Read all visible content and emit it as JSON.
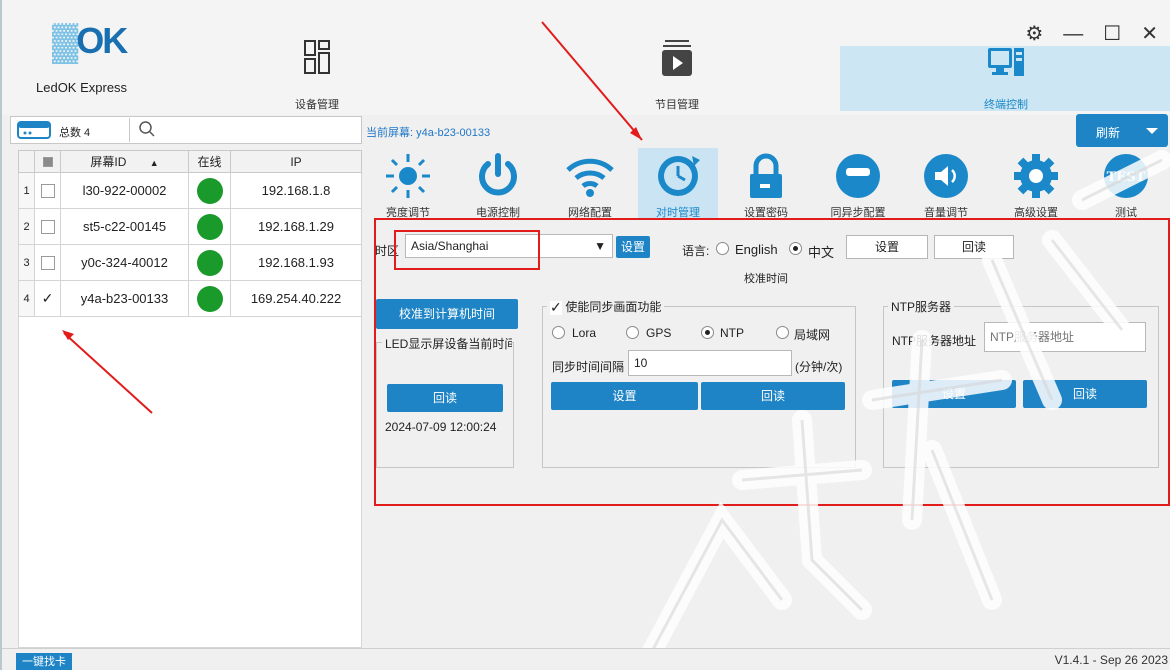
{
  "app": {
    "logo_text": "OK",
    "name": "LedOK Express"
  },
  "nav": {
    "device": {
      "label": "设备管理",
      "icon": "device-manage-icon"
    },
    "program": {
      "label": "节目管理",
      "icon": "program-manage-icon"
    },
    "terminal": {
      "label": "终端控制",
      "icon": "terminal-control-icon"
    }
  },
  "window_controls": {
    "settings": "⚙",
    "minimize": "—",
    "maximize": "☐",
    "close": "✕"
  },
  "toolbar": {
    "total_label": "总数 4",
    "search_placeholder": ""
  },
  "table": {
    "headers": {
      "screen_id": "屏幕ID",
      "online": "在线",
      "ip": "IP"
    },
    "rows": [
      {
        "index": "1",
        "checked": false,
        "id": "l30-922-00002",
        "ip": "192.168.1.8"
      },
      {
        "index": "2",
        "checked": false,
        "id": "st5-c22-00145",
        "ip": "192.168.1.29"
      },
      {
        "index": "3",
        "checked": false,
        "id": "y0c-324-40012",
        "ip": "192.168.1.93"
      },
      {
        "index": "4",
        "checked": true,
        "id": "y4a-b23-00133",
        "ip": "169.254.40.222"
      }
    ]
  },
  "current_screen": "当前屏幕: y4a-b23-00133",
  "refresh_label": "刷新",
  "tools": [
    {
      "label": "亮度调节",
      "icon": "brightness-icon"
    },
    {
      "label": "电源控制",
      "icon": "power-icon"
    },
    {
      "label": "网络配置",
      "icon": "wifi-icon"
    },
    {
      "label": "对时管理",
      "icon": "clock-sync-icon"
    },
    {
      "label": "设置密码",
      "icon": "lock-icon"
    },
    {
      "label": "同异步配置",
      "icon": "sync-config-icon"
    },
    {
      "label": "音量调节",
      "icon": "volume-icon"
    },
    {
      "label": "高级设置",
      "icon": "gear-icon"
    },
    {
      "label": "测试",
      "icon": "test-icon"
    }
  ],
  "timezone": {
    "label": "时区",
    "value": "Asia/Shanghai",
    "set_label": "设置"
  },
  "language": {
    "label": "语言:",
    "options": [
      "English",
      "中文"
    ],
    "selected": "中文",
    "set_label": "设置",
    "read_label": "回读"
  },
  "calibrate_title": "校准时间",
  "calibrate_pc_label": "校准到计算机时间",
  "led_group": {
    "title": "LED显示屏设备当前时间",
    "read_label": "回读",
    "time": "2024-07-09 12:00:24"
  },
  "sync_group": {
    "title": "使能同步画面功能",
    "checked": true,
    "options": [
      "Lora",
      "GPS",
      "NTP",
      "局域网"
    ],
    "selected": "NTP",
    "interval_label": "同步时间间隔",
    "interval_value": "10",
    "interval_unit": "(分钟/次)",
    "set_label": "设置",
    "read_label": "回读"
  },
  "ntp_group": {
    "title": "NTP服务器",
    "address_label": "NTP服务器地址",
    "address_placeholder": "NTP服务器地址",
    "set_label": "设置",
    "read_label": "回读"
  },
  "status_bar": {
    "find_card": "一键找卡",
    "version": "V1.4.1 - Sep 26 2023"
  },
  "watermark_text": "科技有限公司",
  "colors": {
    "accent": "#1e84c6",
    "highlight": "#e21b1b",
    "online": "#1a9a2a"
  }
}
